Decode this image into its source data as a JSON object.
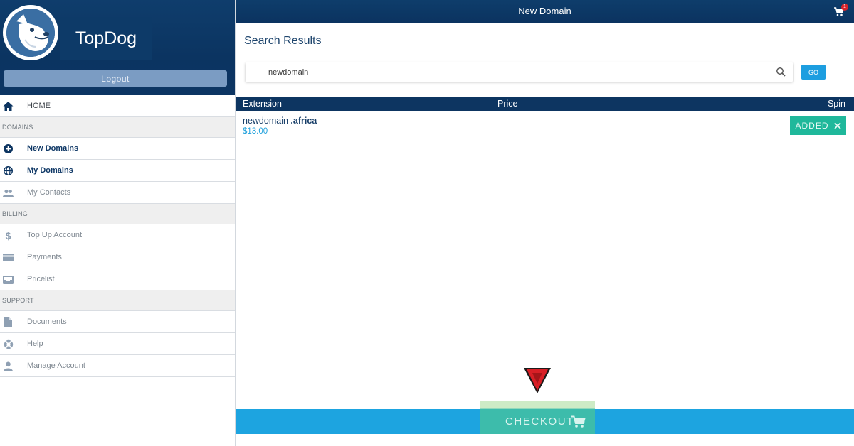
{
  "sidebar": {
    "brand": "TopDog",
    "logout_label": "Logout",
    "home": "HOME",
    "sections": {
      "domains": "DOMAINS",
      "billing": "BILLING",
      "support": "SUPPORT"
    },
    "items": {
      "new_domains": "New Domains",
      "my_domains": "My Domains",
      "my_contacts": "My Contacts",
      "top_up": "Top Up Account",
      "payments": "Payments",
      "pricelist": "Pricelist",
      "documents": "Documents",
      "help": "Help",
      "manage_account": "Manage Account"
    }
  },
  "topbar": {
    "title": "New Domain",
    "cart_count": "1"
  },
  "search": {
    "heading": "Search Results",
    "value": "newdomain",
    "go_label": "GO"
  },
  "table": {
    "headers": {
      "extension": "Extension",
      "price": "Price",
      "spin": "Spin"
    },
    "rows": [
      {
        "name": "newdomain",
        "extension": ".africa",
        "price": "$13.00",
        "status_label": "ADDED"
      }
    ]
  },
  "checkout": {
    "label": "CHECKOUT"
  },
  "colors": {
    "navy": "#0d3561",
    "accent_blue": "#1da4e0",
    "teal": "#1fb89b",
    "badge_red": "#d8232a"
  }
}
